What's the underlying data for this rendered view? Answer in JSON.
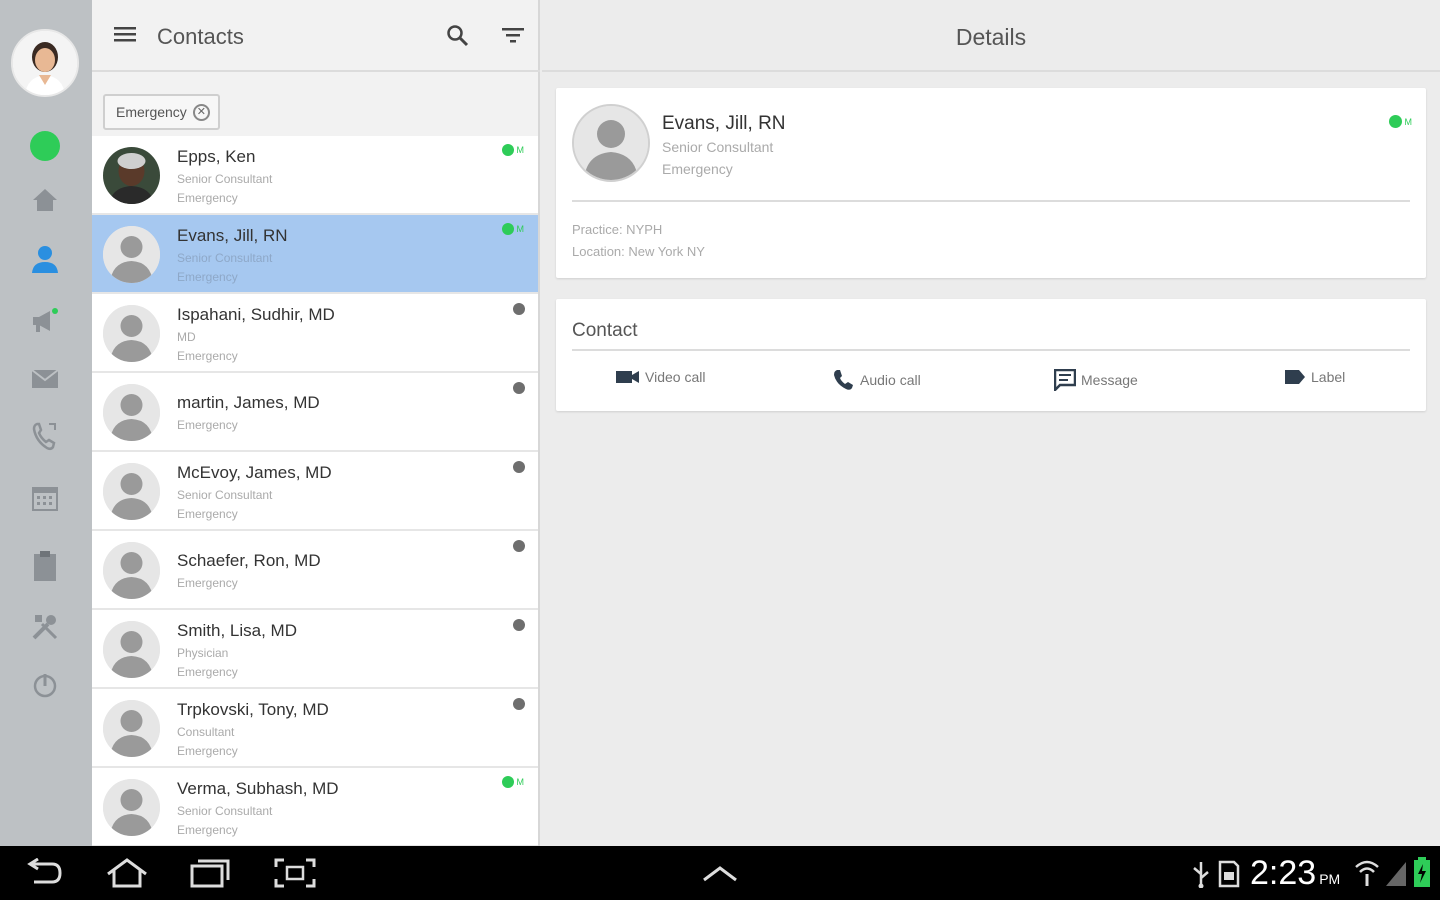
{
  "rail": {
    "presence_color": "#2ecc58",
    "icons": [
      "home-icon",
      "contacts-icon",
      "broadcast-icon",
      "mail-icon",
      "call-history-icon",
      "calendar-icon",
      "clipboard-icon",
      "tools-icon",
      "power-icon"
    ]
  },
  "contacts_header": {
    "title": "Contacts"
  },
  "filter_chip": {
    "label": "Emergency"
  },
  "contacts": [
    {
      "name": "Epps, Ken",
      "line1": "Senior Consultant",
      "line2": "Emergency",
      "presence": "online",
      "presence_label": "M",
      "photo": "real"
    },
    {
      "name": "Evans, Jill, RN",
      "line1": "Senior Consultant",
      "line2": "Emergency",
      "presence": "online",
      "presence_label": "M",
      "selected": true
    },
    {
      "name": "Ispahani, Sudhir, MD",
      "line1": "MD",
      "line2": "Emergency",
      "presence": "offline"
    },
    {
      "name": "martin, James, MD",
      "line1": "Emergency",
      "line2": "",
      "presence": "offline"
    },
    {
      "name": "McEvoy, James, MD",
      "line1": "Senior Consultant",
      "line2": "Emergency",
      "presence": "offline"
    },
    {
      "name": "Schaefer, Ron, MD",
      "line1": "Emergency",
      "line2": "",
      "presence": "offline"
    },
    {
      "name": "Smith, Lisa, MD",
      "line1": "Physician",
      "line2": "Emergency",
      "presence": "offline"
    },
    {
      "name": "Trpkovski, Tony, MD",
      "line1": "Consultant",
      "line2": "Emergency",
      "presence": "offline"
    },
    {
      "name": "Verma, Subhash, MD",
      "line1": "Senior Consultant",
      "line2": "Emergency",
      "presence": "online",
      "presence_label": "M"
    }
  ],
  "details_header": {
    "title": "Details"
  },
  "profile": {
    "name": "Evans, Jill, RN",
    "role": "Senior Consultant",
    "department": "Emergency",
    "presence_label": "M",
    "practice": "Practice: NYPH",
    "location": "Location: New York NY"
  },
  "contact_card": {
    "heading": "Contact",
    "actions": [
      {
        "label": "Video call",
        "icon": "video-icon"
      },
      {
        "label": "Audio call",
        "icon": "phone-icon"
      },
      {
        "label": "Message",
        "icon": "message-icon"
      },
      {
        "label": "Label",
        "icon": "label-icon"
      }
    ]
  },
  "system_bar": {
    "time": "2:23",
    "ampm": "PM"
  },
  "colors": {
    "selected_row": "#a6c8f0",
    "online": "#2ecc58",
    "accent": "#2a8fe0"
  }
}
